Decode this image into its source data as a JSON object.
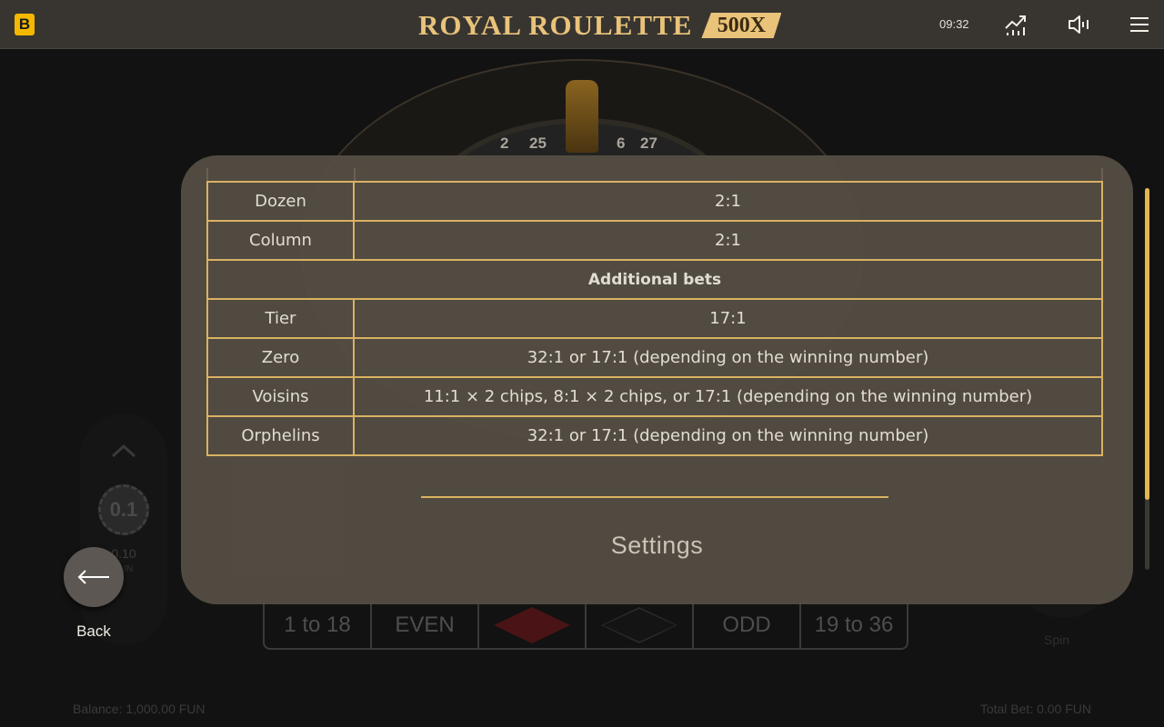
{
  "header": {
    "brand_letter": "B",
    "title": "ROYAL ROULETTE",
    "badge": "500X",
    "clock": "09:32"
  },
  "icons": {
    "stats": "stats-chart-icon",
    "sound": "volume-low-icon",
    "menu": "hamburger-menu-icon",
    "back": "arrow-left-icon"
  },
  "background": {
    "wheel_numbers": [
      "2",
      "25",
      "6",
      "27"
    ],
    "bet_strip": [
      "1 to 18",
      "EVEN",
      "",
      "",
      "ODD",
      "19 to 36"
    ],
    "chip_value": "0.1",
    "chip_amount": "0.10",
    "chip_currency": "FUN",
    "spin_label": "Spin",
    "balance": "Balance: 1,000.00 FUN",
    "total_bet": "Total Bet: 0.00 FUN"
  },
  "payout_table": {
    "rows": [
      {
        "bet": "Dozen",
        "payout": "2:1"
      },
      {
        "bet": "Column",
        "payout": "2:1"
      }
    ],
    "section_title": "Additional bets",
    "additional_rows": [
      {
        "bet": "Tier",
        "payout": "17:1"
      },
      {
        "bet": "Zero",
        "payout": "32:1 or 17:1 (depending on the winning number)"
      },
      {
        "bet": "Voisins",
        "payout": "11:1 × 2 chips, 8:1 × 2 chips, or 17:1 (depending on the winning number)"
      },
      {
        "bet": "Orphelins",
        "payout": "32:1 or 17:1 (depending on the winning number)"
      }
    ]
  },
  "settings_heading": "Settings",
  "back_label": "Back",
  "colors": {
    "accent_gold": "#d9b262",
    "brand_yellow": "#f5b800",
    "modal_bg": "#544d44"
  }
}
